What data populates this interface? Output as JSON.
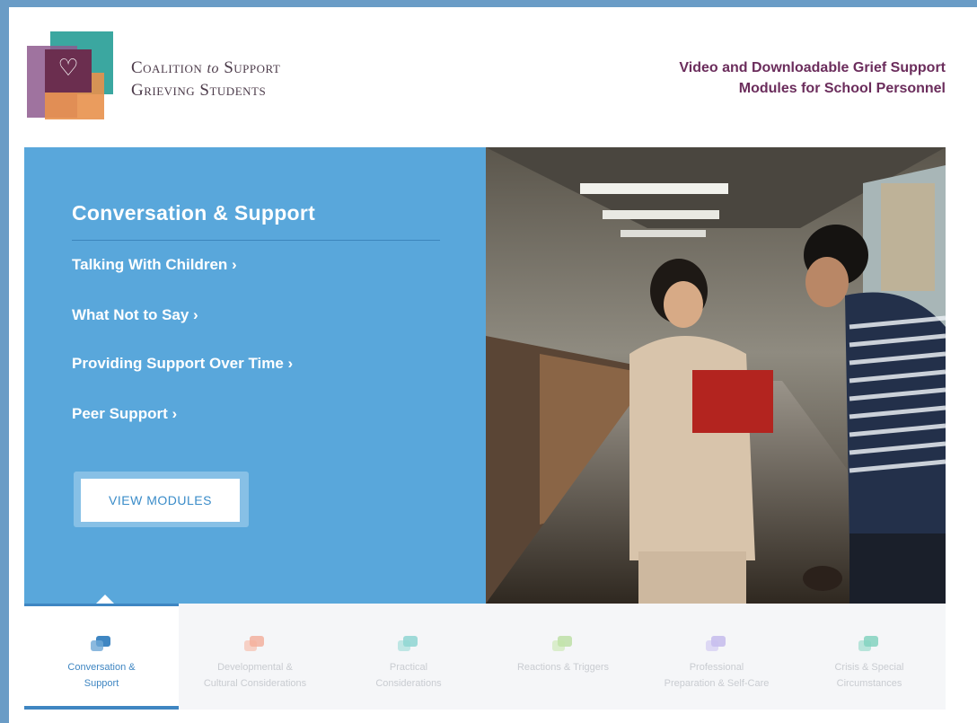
{
  "header": {
    "logo_glyph": "♡",
    "logo_line1": [
      "Coalition",
      "to",
      "Support"
    ],
    "logo_line2": "Grieving Students",
    "tagline_line1": "Video and Downloadable Grief Support",
    "tagline_line2": "Modules for School Personnel"
  },
  "hero": {
    "title": "Conversation & Support",
    "links": [
      {
        "label": "Talking With Children ›"
      },
      {
        "label": "What Not to Say ›"
      },
      {
        "label": "Providing Support Over Time ›"
      },
      {
        "label": "Peer Support ›"
      }
    ],
    "button_label": "VIEW MODULES"
  },
  "tabs": [
    {
      "line1": "Conversation &",
      "line2": "Support",
      "color": "#3f86c2",
      "active": true
    },
    {
      "line1": "Developmental &",
      "line2": "Cultural Considerations",
      "color": "#f08b6e",
      "active": false
    },
    {
      "line1": "Practical",
      "line2": "Considerations",
      "color": "#55c2bd",
      "active": false
    },
    {
      "line1": "Reactions & Triggers",
      "line2": "",
      "color": "#9ed47a",
      "active": false
    },
    {
      "line1": "Professional",
      "line2": "Preparation & Self-Care",
      "color": "#a99ae6",
      "active": false
    },
    {
      "line1": "Crisis & Special",
      "line2": "Circumstances",
      "color": "#45bfa0",
      "active": false
    }
  ]
}
